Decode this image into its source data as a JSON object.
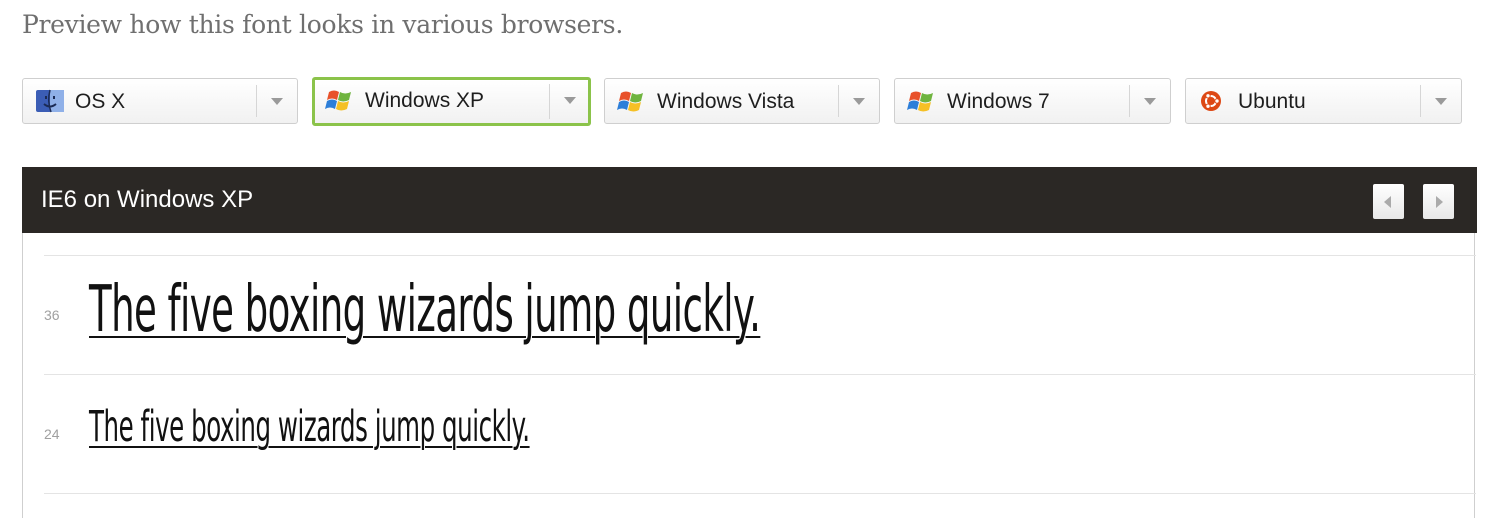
{
  "intro": "Preview how this font looks in various browsers.",
  "os_options": [
    {
      "label": "OS X",
      "icon": "finder-icon",
      "selected": false
    },
    {
      "label": "Windows XP",
      "icon": "windows-flag-icon",
      "selected": true
    },
    {
      "label": "Windows Vista",
      "icon": "windows-flag-icon",
      "selected": false
    },
    {
      "label": "Windows 7",
      "icon": "windows-flag-icon",
      "selected": false
    },
    {
      "label": "Ubuntu",
      "icon": "ubuntu-logo-icon",
      "selected": false
    }
  ],
  "colors": {
    "selected_border": "#8bc34a",
    "header_bg": "#2b2825",
    "ubuntu_orange": "#dd4814"
  },
  "preview": {
    "title": "IE6 on Windows XP",
    "samples": [
      {
        "size": "36",
        "text": "The five boxing wizards jump quickly."
      },
      {
        "size": "24",
        "text": "The five boxing wizards jump quickly."
      }
    ]
  }
}
